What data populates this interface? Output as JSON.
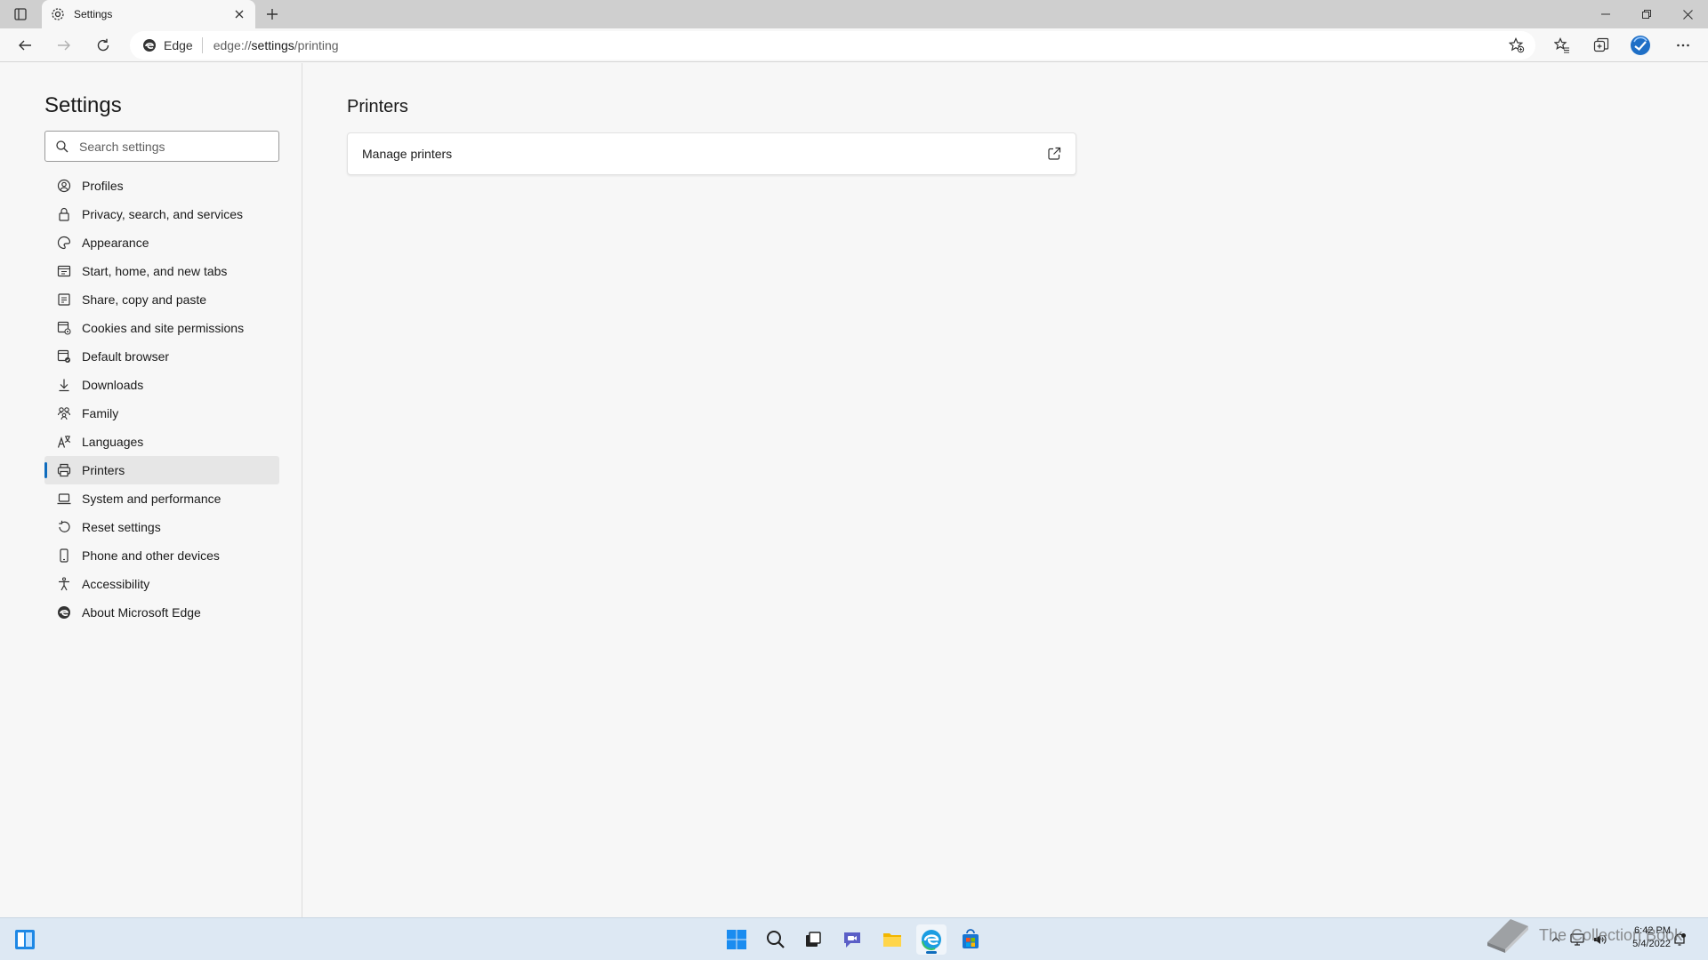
{
  "browser": {
    "tab": {
      "title": "Settings"
    },
    "address": {
      "brand": "Edge",
      "url_prefix": "edge://",
      "url_path": "settings",
      "url_suffix": "/printing"
    }
  },
  "sidebar": {
    "title": "Settings",
    "search_placeholder": "Search settings",
    "items": [
      {
        "label": "Profiles",
        "icon": "profile-icon"
      },
      {
        "label": "Privacy, search, and services",
        "icon": "lock-icon"
      },
      {
        "label": "Appearance",
        "icon": "appearance-icon"
      },
      {
        "label": "Start, home, and new tabs",
        "icon": "home-tabs-icon"
      },
      {
        "label": "Share, copy and paste",
        "icon": "share-icon"
      },
      {
        "label": "Cookies and site permissions",
        "icon": "cookies-icon"
      },
      {
        "label": "Default browser",
        "icon": "default-browser-icon"
      },
      {
        "label": "Downloads",
        "icon": "download-icon"
      },
      {
        "label": "Family",
        "icon": "family-icon"
      },
      {
        "label": "Languages",
        "icon": "languages-icon"
      },
      {
        "label": "Printers",
        "icon": "printer-icon",
        "active": true
      },
      {
        "label": "System and performance",
        "icon": "laptop-icon"
      },
      {
        "label": "Reset settings",
        "icon": "reset-icon"
      },
      {
        "label": "Phone and other devices",
        "icon": "phone-icon"
      },
      {
        "label": "Accessibility",
        "icon": "accessibility-icon"
      },
      {
        "label": "About Microsoft Edge",
        "icon": "edge-icon"
      }
    ]
  },
  "main": {
    "heading": "Printers",
    "card": {
      "label": "Manage printers",
      "icon": "external-link-icon"
    }
  },
  "taskbar": {
    "watermark": "The Collection Book",
    "time": "6:42 PM",
    "date": "5/4/2022"
  },
  "colors": {
    "accent": "#0f6cbd",
    "taskbar": "#dde8f3"
  }
}
